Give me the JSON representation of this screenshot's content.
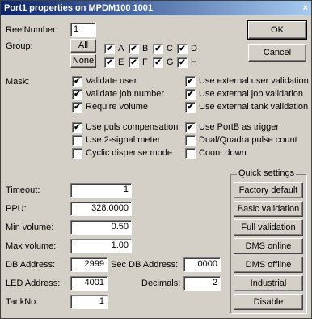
{
  "window": {
    "title": "Port1 properties on MPDM100 1001",
    "close_glyph": "×"
  },
  "reel": {
    "label": "ReelNumber:",
    "value": "1"
  },
  "group": {
    "label": "Group:",
    "all_button": "All",
    "none_button": "None",
    "checks": [
      {
        "label": "A",
        "checked": true
      },
      {
        "label": "B",
        "checked": true
      },
      {
        "label": "C",
        "checked": true
      },
      {
        "label": "D",
        "checked": true
      },
      {
        "label": "E",
        "checked": true
      },
      {
        "label": "F",
        "checked": true
      },
      {
        "label": "G",
        "checked": true
      },
      {
        "label": "H",
        "checked": true
      }
    ]
  },
  "buttons": {
    "ok": "OK",
    "cancel": "Cancel"
  },
  "mask": {
    "label": "Mask:",
    "options": [
      {
        "label": "Validate user",
        "checked": true
      },
      {
        "label": "Use external user validation",
        "checked": true
      },
      {
        "label": "Validate job number",
        "checked": true
      },
      {
        "label": "Use external job validation",
        "checked": true
      },
      {
        "label": "Require volume",
        "checked": true
      },
      {
        "label": "Use external tank validation",
        "checked": true
      },
      {
        "label": "Use puls compensation",
        "checked": true
      },
      {
        "label": "Use PortB as trigger",
        "checked": true
      },
      {
        "label": "Use 2-signal meter",
        "checked": false
      },
      {
        "label": "Dual/Quadra pulse count",
        "checked": false
      },
      {
        "label": "Cyclic dispense mode",
        "checked": false
      },
      {
        "label": "Count down",
        "checked": false
      }
    ]
  },
  "fields": {
    "timeout": {
      "label": "Timeout:",
      "value": "1"
    },
    "ppu": {
      "label": "PPU:",
      "value": "328.0000"
    },
    "min_volume": {
      "label": "Min volume:",
      "value": "0.50"
    },
    "max_volume": {
      "label": "Max volume:",
      "value": "1.00"
    },
    "db_address": {
      "label": "DB Address:",
      "value": "2999"
    },
    "sec_db_address": {
      "label": "Sec DB Address:",
      "value": "0000"
    },
    "led_address": {
      "label": "LED Address:",
      "value": "4001"
    },
    "decimals": {
      "label": "Decimals:",
      "value": "2"
    },
    "tank_no": {
      "label": "TankNo:",
      "value": "1"
    }
  },
  "quick_settings": {
    "title": "Quick settings",
    "buttons": [
      "Factory default",
      "Basic validation",
      "Full validation",
      "DMS online",
      "DMS offline",
      "Industrial",
      "Disable"
    ]
  }
}
